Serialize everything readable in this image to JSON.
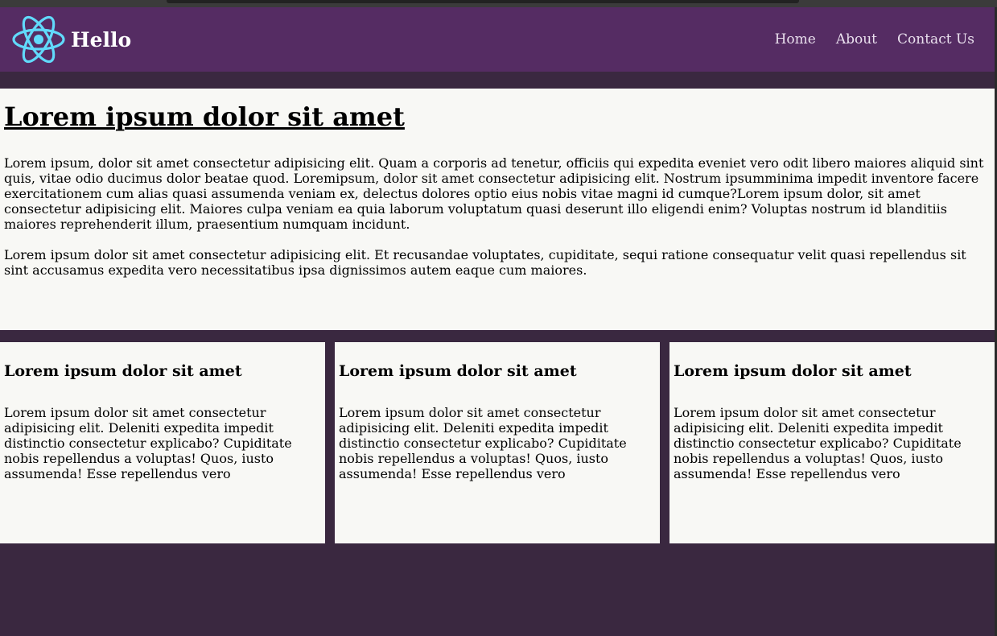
{
  "header": {
    "brand": "Hello",
    "logo_icon": "react-atom-icon",
    "logo_color": "#61dafb",
    "nav": [
      "Home",
      "About",
      "Contact Us"
    ]
  },
  "hero": {
    "title": "Lorem ipsum dolor sit amet",
    "paragraphs": [
      "Lorem ipsum, dolor sit amet consectetur adipisicing elit. Quam a corporis ad tenetur, officiis qui expedita eveniet vero odit libero maiores aliquid sint quis, vitae odio ducimus dolor beatae quod. Loremipsum, dolor sit amet consectetur adipisicing elit. Nostrum ipsumminima impedit inventore facere exercitationem cum alias quasi assumenda veniam ex, delectus dolores optio eius nobis vitae magni id cumque?Lorem ipsum dolor, sit amet consectetur adipisicing elit. Maiores culpa veniam ea quia laborum voluptatum quasi deserunt illo eligendi enim? Voluptas nostrum id blanditiis maiores reprehenderit illum, praesentium numquam incidunt.",
      "Lorem ipsum dolor sit amet consectetur adipisicing elit. Et recusandae voluptates, cupiditate, sequi ratione consequatur velit quasi repellendus sit sint accusamus expedita vero necessitatibus ipsa dignissimos autem eaque cum maiores."
    ]
  },
  "cards": [
    {
      "title": "Lorem ipsum dolor sit amet",
      "text": "Lorem ipsum dolor sit amet consectetur adipisicing elit. Deleniti expedita impedit distinctio consectetur explicabo? Cupiditate nobis repellendus a voluptas! Quos, iusto assumenda! Esse repellendus vero"
    },
    {
      "title": "Lorem ipsum dolor sit amet",
      "text": "Lorem ipsum dolor sit amet consectetur adipisicing elit. Deleniti expedita impedit distinctio consectetur explicabo? Cupiditate nobis repellendus a voluptas! Quos, iusto assumenda! Esse repellendus vero"
    },
    {
      "title": "Lorem ipsum dolor sit amet",
      "text": "Lorem ipsum dolor sit amet consectetur adipisicing elit. Deleniti expedita impedit distinctio consectetur explicabo? Cupiditate nobis repellendus a voluptas! Quos, iusto assumenda! Esse repellendus vero"
    }
  ],
  "colors": {
    "navbar": "#552c63",
    "page_background": "#3a2840",
    "content_background": "#f8f8f5"
  }
}
